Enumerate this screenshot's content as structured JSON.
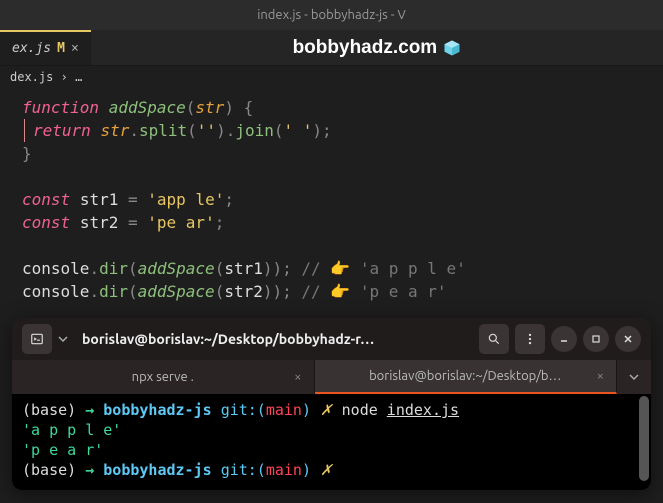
{
  "window": {
    "title": "index.js - bobbyhadz-js - V"
  },
  "tab": {
    "filename": "ex.js",
    "modified_marker": "M",
    "close_glyph": "×"
  },
  "site": {
    "name": "bobbyhadz.com"
  },
  "breadcrumb": {
    "file": "dex.js",
    "sep": "›",
    "more": "…"
  },
  "code": {
    "l1_function": "function",
    "l1_name": "addSpace",
    "l1_param": "str",
    "l2_return": "return",
    "l2_str": "str",
    "l2_split": "split",
    "l2_arg1": "''",
    "l2_join": "join",
    "l2_arg2": "' '",
    "l5_const": "const",
    "l5_var": "str1",
    "l5_val": "'app  le'",
    "l6_const": "const",
    "l6_var": "str2",
    "l6_val": "'pe ar'",
    "l8_console": "console",
    "l8_dir": "dir",
    "l8_fn": "addSpace",
    "l8_arg": "str1",
    "l8_comment": "// 👉️ 'a p p    l e'",
    "l9_console": "console",
    "l9_dir": "dir",
    "l9_fn": "addSpace",
    "l9_arg": "str2",
    "l9_comment": "// 👉️ 'p e   a r'"
  },
  "terminal": {
    "header_title": "borislav@borislav:~/Desktop/bobbyhadz-r…",
    "tab1": "npx serve .",
    "tab2": "borislav@borislav:~/Desktop/b…",
    "prompt_base": "(base)",
    "prompt_arrow": "→",
    "prompt_dir": "bobbyhadz-js",
    "prompt_git": "git:(",
    "prompt_branch": "main",
    "prompt_git_close": ")",
    "prompt_x": "✗",
    "cmd_node": "node",
    "cmd_file": "index.js",
    "out1": "'a p p    l e'",
    "out2": "'p e   a r'"
  }
}
